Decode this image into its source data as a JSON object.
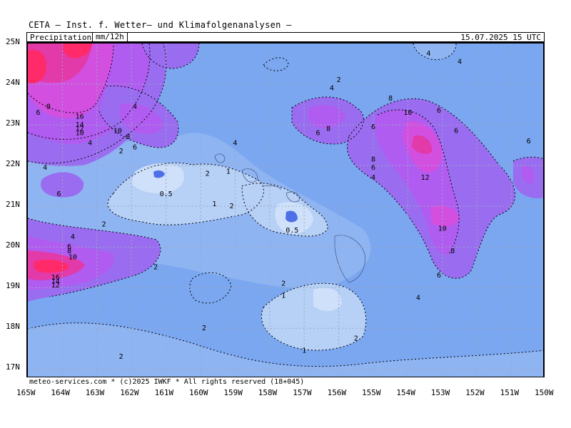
{
  "header": {
    "title": "CETA – Inst. f. Wetter– und Klimafolgenanalysen –",
    "parameter": "Precipitation",
    "unit": "mm/12h",
    "datetime": "15.07.2025 15 UTC"
  },
  "footer": {
    "credit": "meteo-services.com * (c)2025 IWKF * All rights reserved (18+045)"
  },
  "axes": {
    "lat_labels": [
      "25N",
      "24N",
      "23N",
      "22N",
      "21N",
      "20N",
      "19N",
      "18N",
      "17N"
    ],
    "lon_labels": [
      "165W",
      "164W",
      "163W",
      "162W",
      "161W",
      "160W",
      "159W",
      "158W",
      "157W",
      "156W",
      "155W",
      "154W",
      "153W",
      "152W",
      "151W",
      "150W"
    ]
  },
  "colors": {
    "level_0_5": "#cfe0fa",
    "level_1": "#b7d0f6",
    "level_2": "#7aa7f0",
    "level_4": "#6d95ee",
    "level_6": "#9a6cf0",
    "level_8": "#b15cf0",
    "level_10": "#d34fe0",
    "level_12": "#e23aa8",
    "level_16": "#ff2a6a",
    "blob_dark": "#4f6fe8"
  },
  "contour_labels": [
    {
      "text": "6",
      "lon": -164.7,
      "lat": 23.25
    },
    {
      "text": "8",
      "lon": -164.4,
      "lat": 23.4
    },
    {
      "text": "4",
      "lon": -164.5,
      "lat": 21.9
    },
    {
      "text": "6",
      "lon": -164.1,
      "lat": 21.25
    },
    {
      "text": "16",
      "lon": -163.5,
      "lat": 23.15
    },
    {
      "text": "14",
      "lon": -163.5,
      "lat": 22.95
    },
    {
      "text": "12",
      "lon": -163.5,
      "lat": 22.85
    },
    {
      "text": "10",
      "lon": -163.5,
      "lat": 22.75
    },
    {
      "text": "4",
      "lon": -161.9,
      "lat": 23.4
    },
    {
      "text": "10",
      "lon": -162.4,
      "lat": 22.8
    },
    {
      "text": "8",
      "lon": -162.1,
      "lat": 22.65
    },
    {
      "text": "6",
      "lon": -161.9,
      "lat": 22.4
    },
    {
      "text": "4",
      "lon": -163.2,
      "lat": 22.5
    },
    {
      "text": "2",
      "lon": -162.3,
      "lat": 22.3
    },
    {
      "text": "0.5",
      "lon": -161.0,
      "lat": 21.25
    },
    {
      "text": "2",
      "lon": -159.8,
      "lat": 21.75
    },
    {
      "text": "1",
      "lon": -159.2,
      "lat": 21.8
    },
    {
      "text": "4",
      "lon": -159.0,
      "lat": 22.5
    },
    {
      "text": "1",
      "lon": -159.6,
      "lat": 21.0
    },
    {
      "text": "2",
      "lon": -159.1,
      "lat": 20.95
    },
    {
      "text": "0.5",
      "lon": -157.35,
      "lat": 20.35
    },
    {
      "text": "2",
      "lon": -162.8,
      "lat": 20.5
    },
    {
      "text": "4",
      "lon": -163.7,
      "lat": 20.2
    },
    {
      "text": "6",
      "lon": -163.8,
      "lat": 19.95
    },
    {
      "text": "8",
      "lon": -163.8,
      "lat": 19.85
    },
    {
      "text": "10",
      "lon": -163.7,
      "lat": 19.7
    },
    {
      "text": "2",
      "lon": -161.3,
      "lat": 19.45
    },
    {
      "text": "16",
      "lon": -164.2,
      "lat": 19.2
    },
    {
      "text": "14",
      "lon": -164.2,
      "lat": 19.1
    },
    {
      "text": "12",
      "lon": -164.2,
      "lat": 19.0
    },
    {
      "text": "2",
      "lon": -157.6,
      "lat": 19.05
    },
    {
      "text": "1",
      "lon": -157.6,
      "lat": 18.75
    },
    {
      "text": "2",
      "lon": -159.9,
      "lat": 17.95
    },
    {
      "text": "2",
      "lon": -162.3,
      "lat": 17.25
    },
    {
      "text": "1",
      "lon": -157.0,
      "lat": 17.4
    },
    {
      "text": "2",
      "lon": -155.5,
      "lat": 17.7
    },
    {
      "text": "2",
      "lon": -156.0,
      "lat": 24.05
    },
    {
      "text": "4",
      "lon": -156.2,
      "lat": 23.85
    },
    {
      "text": "6",
      "lon": -156.6,
      "lat": 22.75
    },
    {
      "text": "8",
      "lon": -156.3,
      "lat": 22.85
    },
    {
      "text": "6",
      "lon": -155.0,
      "lat": 22.9
    },
    {
      "text": "8",
      "lon": -154.5,
      "lat": 23.6
    },
    {
      "text": "10",
      "lon": -154.0,
      "lat": 23.25
    },
    {
      "text": "6",
      "lon": -153.1,
      "lat": 23.3
    },
    {
      "text": "6",
      "lon": -152.6,
      "lat": 22.8
    },
    {
      "text": "8",
      "lon": -155.0,
      "lat": 22.1
    },
    {
      "text": "6",
      "lon": -155.0,
      "lat": 21.9
    },
    {
      "text": "4",
      "lon": -155.0,
      "lat": 21.65
    },
    {
      "text": "12",
      "lon": -153.5,
      "lat": 21.65
    },
    {
      "text": "10",
      "lon": -153.0,
      "lat": 20.4
    },
    {
      "text": "8",
      "lon": -152.7,
      "lat": 19.85
    },
    {
      "text": "6",
      "lon": -153.1,
      "lat": 19.25
    },
    {
      "text": "4",
      "lon": -153.7,
      "lat": 18.7
    },
    {
      "text": "4",
      "lon": -153.4,
      "lat": 24.7
    },
    {
      "text": "4",
      "lon": -152.5,
      "lat": 24.5
    },
    {
      "text": "6",
      "lon": -150.5,
      "lat": 22.55
    }
  ]
}
